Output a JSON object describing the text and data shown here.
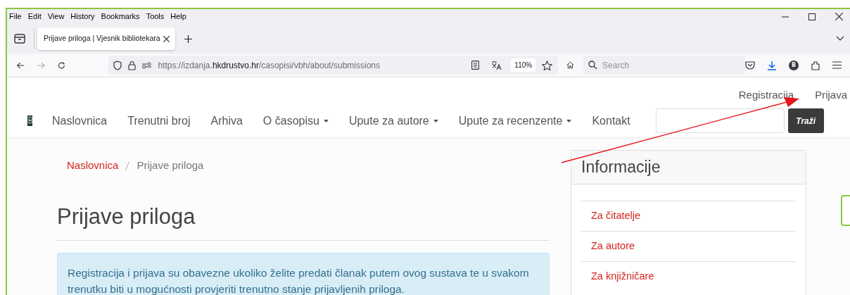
{
  "browser": {
    "menu": [
      "File",
      "Edit",
      "View",
      "History",
      "Bookmarks",
      "Tools",
      "Help"
    ],
    "tab": {
      "title": "Prijave priloga | Vjesnik bibliotekara",
      "selected": true
    },
    "url": {
      "prefix": "https://izdanja.",
      "host": "hkdrustvo.hr",
      "path": "/casopisi/vbh/about/submissions"
    },
    "zoom": "110%",
    "search": {
      "placeholder": "Search"
    },
    "profile": "B"
  },
  "site": {
    "top_links": [
      "Registracija",
      "Prijava"
    ],
    "nav": [
      {
        "label": "Naslovnica",
        "kind": "link"
      },
      {
        "label": "Trenutni broj",
        "kind": "link"
      },
      {
        "label": "Arhiva",
        "kind": "link"
      },
      {
        "label": "O časopisu",
        "kind": "dropdown"
      },
      {
        "label": "Upute za autore",
        "kind": "dropdown"
      },
      {
        "label": "Upute za recenzente",
        "kind": "dropdown"
      },
      {
        "label": "Kontakt",
        "kind": "link"
      }
    ],
    "search_button": "Traži",
    "breadcrumb": [
      {
        "label": "Naslovnica",
        "kind": "link"
      },
      {
        "label": "Prijave priloga",
        "kind": "current"
      }
    ],
    "heading": "Prijave priloga",
    "notice": "Registracija i prijava su obavezne ukoliko želite predati članak putem ovog sustava te u svakom trenutku biti u mogućnosti provjeriti trenutno stanje prijavljenih priloga.",
    "sidebar": {
      "title": "Informacije",
      "links": [
        "Za čitatelje",
        "Za autore",
        "Za knjižničare"
      ]
    }
  }
}
